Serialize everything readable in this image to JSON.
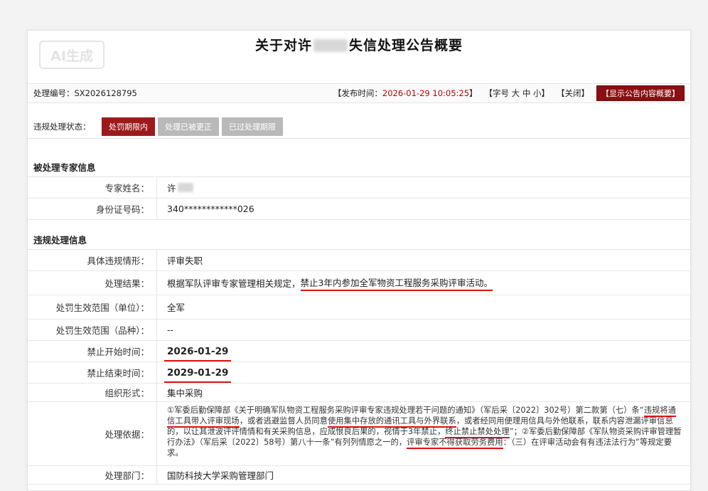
{
  "watermark": "AI生成",
  "title": {
    "prefix": "关于对许",
    "suffix": "失信处理公告概要"
  },
  "meta": {
    "code_label": "处理编号：",
    "code": "SX2026128795",
    "publish_label": "【发布时间：",
    "publish_time": "2026-01-29 10:05:25",
    "publish_end": "】",
    "font_size": "【字号 大 中 小】",
    "close": "【关闭】",
    "summary_button": "【显示公告内容概要】"
  },
  "status": {
    "label": "违规处理状态：",
    "options": [
      {
        "label": "处罚期限内",
        "active": true
      },
      {
        "label": "处理已被更正",
        "active": false
      },
      {
        "label": "已过处理期限",
        "active": false
      }
    ]
  },
  "expert": {
    "heading": "被处理专家信息",
    "name_label": "专家姓名：",
    "name_value": "许",
    "id_label": "身份证号码：",
    "id_value": "340************026"
  },
  "violation": {
    "heading": "违规处理信息",
    "situation_label": "具体违规情形：",
    "situation_value": "评审失职",
    "result_label": "处理结果：",
    "result_prefix": "根据军队评审专家管理相关规定，",
    "result_highlight": "禁止3年内参加全军物资工程服务采购评审活动。",
    "scope_unit_label": "处罚生效范围（单位）：",
    "scope_unit_value": "全军",
    "scope_item_label": "处罚生效范围（品种）：",
    "scope_item_value": "--",
    "start_label": "禁止开始时间：",
    "start_value": "2026-01-29",
    "end_label": "禁止结束时间：",
    "end_value": "2029-01-29",
    "form_label": "组织形式：",
    "form_value": "集中采购",
    "basis_label": "处理依据：",
    "basis": {
      "p1": "①军委后勤保障部《关于明确军队物资工程服务采购评审专家违规处理若干问题的通知》（军后采〔2022〕302号）第二款第（七）条“",
      "u1": "违规将通信工具带入评审现场",
      "p2": "，或者逃避监督人员同意",
      "u2": "使用集中存放的通讯工具与外界联系",
      "p3": "，或者经同用便理用信具与外他联系，联系内容泄漏评审信息的，以让其泄波评评情情和有关采购信息，应成恨良后果的，视情于3年禁止，",
      "u3": "终止禁止禁处处理",
      "p4": "”；②军委后勤保障部《军队物资采购评审管理暂行办法》（军后采〔2022〕58号）第八十一条”有列列情愿之一的，",
      "u4": "评审专家不得获取劳务费用",
      "p5": "：（三）在评审活动会有有违法法行为”等规定要求。"
    },
    "dept_label": "处理部门：",
    "dept_value": "国防科技大学采购管理部门"
  }
}
